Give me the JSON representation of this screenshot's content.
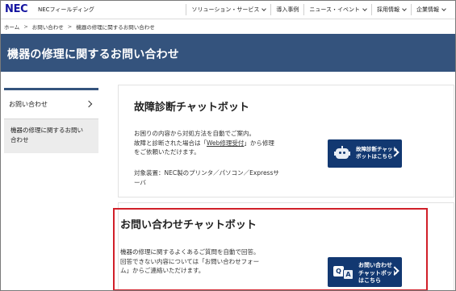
{
  "header": {
    "logo": "NEC",
    "brand": "NECフィールディング",
    "nav": [
      {
        "label": "ソリューション・サービス"
      },
      {
        "label": "導入事例"
      },
      {
        "label": "ニュース・イベント"
      },
      {
        "label": "採用情報"
      },
      {
        "label": "企業情報"
      }
    ]
  },
  "breadcrumb": {
    "items": [
      "ホーム",
      "お問い合わせ",
      "機器の修理に関するお問い合わせ"
    ],
    "separator": ">"
  },
  "hero": {
    "title": "機器の修理に関するお問い合わせ",
    "color": "#34537d"
  },
  "sidebar": {
    "parent": "お問い合わせ",
    "current_line1": "機器の修理に関するお問い",
    "current_line2": "合わせ"
  },
  "card1": {
    "title": "故障診断チャットボット",
    "desc_line1": "お困りの内容から対処方法を自動でご案内。",
    "desc_line2_pre": "故障と診断された場合は「",
    "desc_link": "Web修理受付",
    "desc_line2_post": "」から修理",
    "desc_line3": "をご依頼いただけます。",
    "target_line1": "対象装置：NEC製のプリンタ／パソコン／Expressサ",
    "target_line2": "ーバ",
    "banner_line1": "故障診断チャット",
    "banner_line2": "ボットはこちら",
    "banner_icon": "robot-icon"
  },
  "card2": {
    "title": "お問い合わせチャットボット",
    "desc_line1": "機器の修理に関するよくあるご質問を自動で回答。",
    "desc_line2": "回答できない内容については「お問い合わせフォー",
    "desc_line3": "ム」からご連絡いただけます。",
    "banner_line1": "お問い合わせ",
    "banner_line2": "チャットボット",
    "banner_line3": "はこちら",
    "banner_icon": "qa-bubbles-icon",
    "bubble_q": "Q",
    "bubble_a": "A",
    "highlight_color": "#d11f29"
  }
}
